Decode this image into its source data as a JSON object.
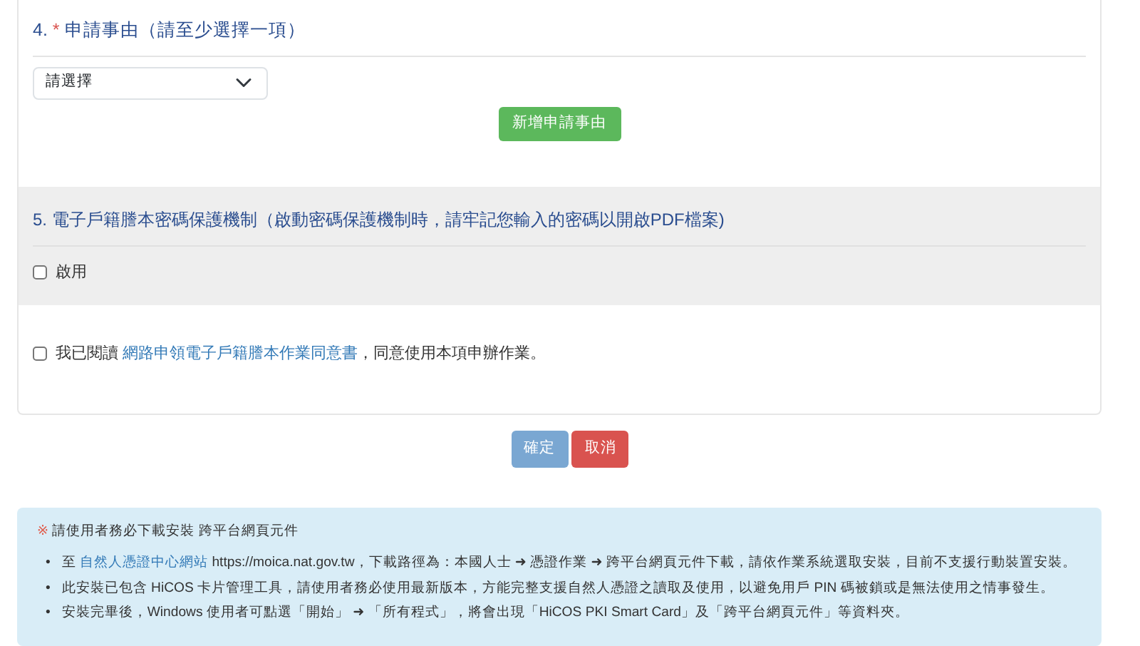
{
  "section4": {
    "number": "4.",
    "required_mark": "*",
    "title": "申請事由（請至少選擇一項）",
    "select": {
      "value": "請選擇"
    },
    "add_button": "新增申請事由"
  },
  "section5": {
    "title": "5. 電子戶籍謄本密碼保護機制（啟動密碼保護機制時，請牢記您輸入的密碼以開啟PDF檔案)",
    "option": {
      "label": "啟用",
      "checked": false
    }
  },
  "agreement": {
    "checked": false,
    "before": "我已閱讀 ",
    "link": "網路申領電子戶籍謄本作業同意書",
    "after": "，同意使用本項申辦作業。"
  },
  "buttons": [
    {
      "label": "確定",
      "kind": "confirm"
    },
    {
      "label": "取消",
      "kind": "cancel"
    }
  ],
  "notice": {
    "mark": "※",
    "title": "請使用者務必下載安裝 跨平台網頁元件",
    "items": [
      {
        "bullet": "•",
        "prefix": "至 ",
        "link": "自然人憑證中心網站",
        "text": " https://moica.nat.gov.tw，下載路徑為：本國人士 ➜ 憑證作業 ➜ 跨平台網頁元件下載，請依作業系統選取安裝，目前不支援行動裝置安裝。"
      },
      {
        "bullet": "•",
        "text": "此安裝已包含 HiCOS 卡片管理工具，請使用者務必使用最新版本，方能完整支援自然人憑證之讀取及使用，以避免用戶 PIN 碼被鎖或是無法使用之情事發生。"
      },
      {
        "bullet": "•",
        "text": "安裝完畢後，Windows 使用者可點選「開始」 ➜ 「所有程式」，將會出現「HiCOS PKI Smart Card」及「跨平台網頁元件」等資料夾。"
      }
    ]
  }
}
